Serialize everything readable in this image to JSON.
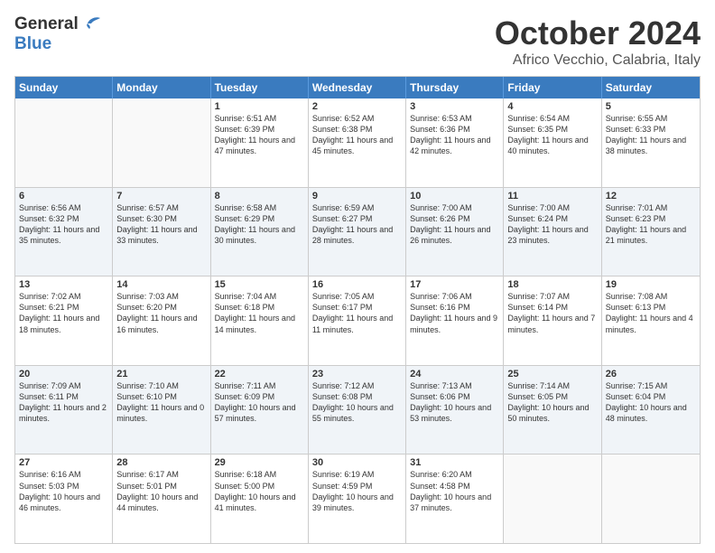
{
  "logo": {
    "line1": "General",
    "line2": "Blue"
  },
  "title": "October 2024",
  "subtitle": "Africo Vecchio, Calabria, Italy",
  "days_of_week": [
    "Sunday",
    "Monday",
    "Tuesday",
    "Wednesday",
    "Thursday",
    "Friday",
    "Saturday"
  ],
  "weeks": [
    [
      {
        "day": "",
        "content": ""
      },
      {
        "day": "",
        "content": ""
      },
      {
        "day": "1",
        "content": "Sunrise: 6:51 AM\nSunset: 6:39 PM\nDaylight: 11 hours and 47 minutes."
      },
      {
        "day": "2",
        "content": "Sunrise: 6:52 AM\nSunset: 6:38 PM\nDaylight: 11 hours and 45 minutes."
      },
      {
        "day": "3",
        "content": "Sunrise: 6:53 AM\nSunset: 6:36 PM\nDaylight: 11 hours and 42 minutes."
      },
      {
        "day": "4",
        "content": "Sunrise: 6:54 AM\nSunset: 6:35 PM\nDaylight: 11 hours and 40 minutes."
      },
      {
        "day": "5",
        "content": "Sunrise: 6:55 AM\nSunset: 6:33 PM\nDaylight: 11 hours and 38 minutes."
      }
    ],
    [
      {
        "day": "6",
        "content": "Sunrise: 6:56 AM\nSunset: 6:32 PM\nDaylight: 11 hours and 35 minutes."
      },
      {
        "day": "7",
        "content": "Sunrise: 6:57 AM\nSunset: 6:30 PM\nDaylight: 11 hours and 33 minutes."
      },
      {
        "day": "8",
        "content": "Sunrise: 6:58 AM\nSunset: 6:29 PM\nDaylight: 11 hours and 30 minutes."
      },
      {
        "day": "9",
        "content": "Sunrise: 6:59 AM\nSunset: 6:27 PM\nDaylight: 11 hours and 28 minutes."
      },
      {
        "day": "10",
        "content": "Sunrise: 7:00 AM\nSunset: 6:26 PM\nDaylight: 11 hours and 26 minutes."
      },
      {
        "day": "11",
        "content": "Sunrise: 7:00 AM\nSunset: 6:24 PM\nDaylight: 11 hours and 23 minutes."
      },
      {
        "day": "12",
        "content": "Sunrise: 7:01 AM\nSunset: 6:23 PM\nDaylight: 11 hours and 21 minutes."
      }
    ],
    [
      {
        "day": "13",
        "content": "Sunrise: 7:02 AM\nSunset: 6:21 PM\nDaylight: 11 hours and 18 minutes."
      },
      {
        "day": "14",
        "content": "Sunrise: 7:03 AM\nSunset: 6:20 PM\nDaylight: 11 hours and 16 minutes."
      },
      {
        "day": "15",
        "content": "Sunrise: 7:04 AM\nSunset: 6:18 PM\nDaylight: 11 hours and 14 minutes."
      },
      {
        "day": "16",
        "content": "Sunrise: 7:05 AM\nSunset: 6:17 PM\nDaylight: 11 hours and 11 minutes."
      },
      {
        "day": "17",
        "content": "Sunrise: 7:06 AM\nSunset: 6:16 PM\nDaylight: 11 hours and 9 minutes."
      },
      {
        "day": "18",
        "content": "Sunrise: 7:07 AM\nSunset: 6:14 PM\nDaylight: 11 hours and 7 minutes."
      },
      {
        "day": "19",
        "content": "Sunrise: 7:08 AM\nSunset: 6:13 PM\nDaylight: 11 hours and 4 minutes."
      }
    ],
    [
      {
        "day": "20",
        "content": "Sunrise: 7:09 AM\nSunset: 6:11 PM\nDaylight: 11 hours and 2 minutes."
      },
      {
        "day": "21",
        "content": "Sunrise: 7:10 AM\nSunset: 6:10 PM\nDaylight: 11 hours and 0 minutes."
      },
      {
        "day": "22",
        "content": "Sunrise: 7:11 AM\nSunset: 6:09 PM\nDaylight: 10 hours and 57 minutes."
      },
      {
        "day": "23",
        "content": "Sunrise: 7:12 AM\nSunset: 6:08 PM\nDaylight: 10 hours and 55 minutes."
      },
      {
        "day": "24",
        "content": "Sunrise: 7:13 AM\nSunset: 6:06 PM\nDaylight: 10 hours and 53 minutes."
      },
      {
        "day": "25",
        "content": "Sunrise: 7:14 AM\nSunset: 6:05 PM\nDaylight: 10 hours and 50 minutes."
      },
      {
        "day": "26",
        "content": "Sunrise: 7:15 AM\nSunset: 6:04 PM\nDaylight: 10 hours and 48 minutes."
      }
    ],
    [
      {
        "day": "27",
        "content": "Sunrise: 6:16 AM\nSunset: 5:03 PM\nDaylight: 10 hours and 46 minutes."
      },
      {
        "day": "28",
        "content": "Sunrise: 6:17 AM\nSunset: 5:01 PM\nDaylight: 10 hours and 44 minutes."
      },
      {
        "day": "29",
        "content": "Sunrise: 6:18 AM\nSunset: 5:00 PM\nDaylight: 10 hours and 41 minutes."
      },
      {
        "day": "30",
        "content": "Sunrise: 6:19 AM\nSunset: 4:59 PM\nDaylight: 10 hours and 39 minutes."
      },
      {
        "day": "31",
        "content": "Sunrise: 6:20 AM\nSunset: 4:58 PM\nDaylight: 10 hours and 37 minutes."
      },
      {
        "day": "",
        "content": ""
      },
      {
        "day": "",
        "content": ""
      }
    ]
  ]
}
